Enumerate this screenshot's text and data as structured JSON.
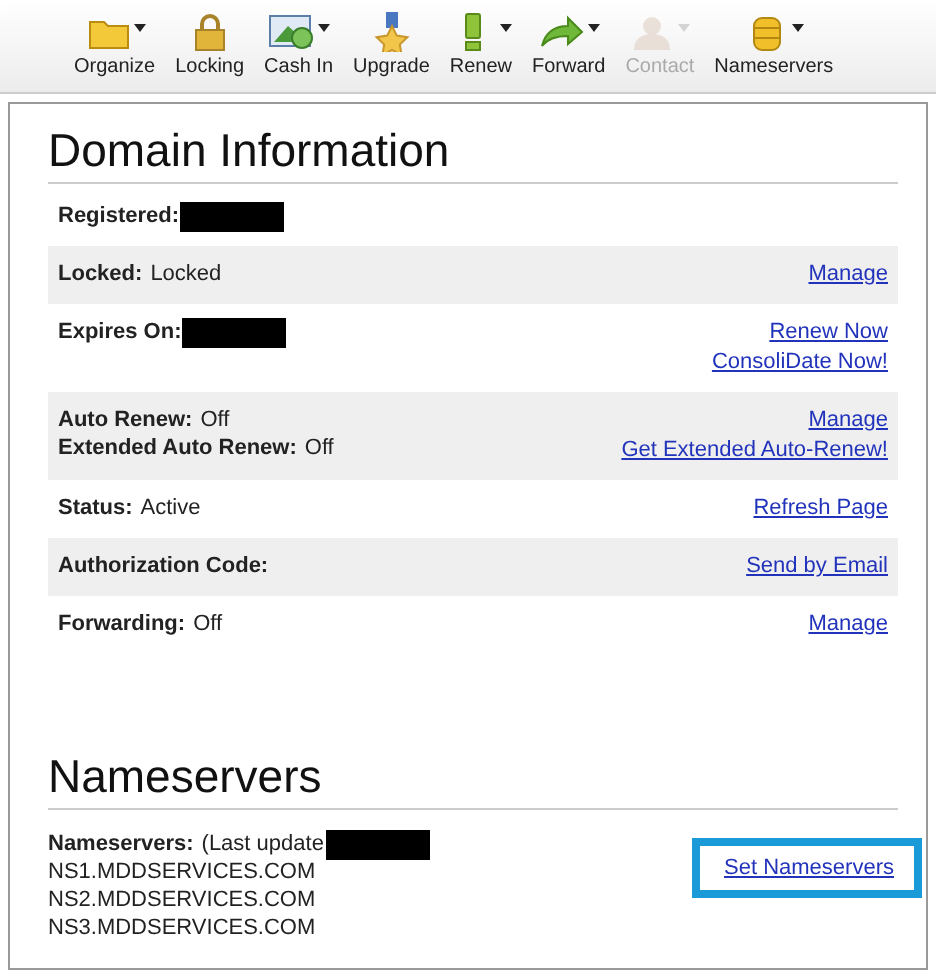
{
  "toolbar": [
    {
      "label": "Organize",
      "kind": "folder",
      "caret": true,
      "disabled": false
    },
    {
      "label": "Locking",
      "kind": "lock",
      "caret": false,
      "disabled": false
    },
    {
      "label": "Cash In",
      "kind": "cash",
      "caret": true,
      "disabled": false
    },
    {
      "label": "Upgrade",
      "kind": "medal",
      "caret": false,
      "disabled": false
    },
    {
      "label": "Renew",
      "kind": "exclaim",
      "caret": true,
      "disabled": false
    },
    {
      "label": "Forward",
      "kind": "arrow",
      "caret": true,
      "disabled": false
    },
    {
      "label": "Contact",
      "kind": "person",
      "caret": true,
      "disabled": true
    },
    {
      "label": "Nameservers",
      "kind": "database",
      "caret": true,
      "disabled": false
    }
  ],
  "domain_info": {
    "title": "Domain Information",
    "rows": [
      {
        "lines": [
          {
            "label": "Registered:",
            "redacted": true
          }
        ],
        "links": []
      },
      {
        "lines": [
          {
            "label": "Locked:",
            "value": "Locked"
          }
        ],
        "links": [
          "Manage"
        ]
      },
      {
        "lines": [
          {
            "label": "Expires On:",
            "redacted": true
          }
        ],
        "links": [
          "Renew Now",
          "ConsoliDate Now!"
        ]
      },
      {
        "lines": [
          {
            "label": "Auto Renew:",
            "value": "Off"
          },
          {
            "label": "Extended Auto Renew:",
            "value": "Off"
          }
        ],
        "links": [
          "Manage",
          "Get Extended Auto-Renew!"
        ]
      },
      {
        "lines": [
          {
            "label": "Status:",
            "value": "Active"
          }
        ],
        "links": [
          "Refresh Page"
        ]
      },
      {
        "lines": [
          {
            "label": "Authorization Code:"
          }
        ],
        "links": [
          "Send by Email"
        ]
      },
      {
        "lines": [
          {
            "label": "Forwarding:",
            "value": "Off"
          }
        ],
        "links": [
          "Manage"
        ]
      }
    ]
  },
  "nameservers": {
    "title": "Nameservers",
    "label": "Nameservers:",
    "note": "(Last update",
    "servers": [
      "NS1.MDDSERVICES.COM",
      "NS2.MDDSERVICES.COM",
      "NS3.MDDSERVICES.COM"
    ],
    "link": "Set Nameservers",
    "link_highlighted": true
  }
}
